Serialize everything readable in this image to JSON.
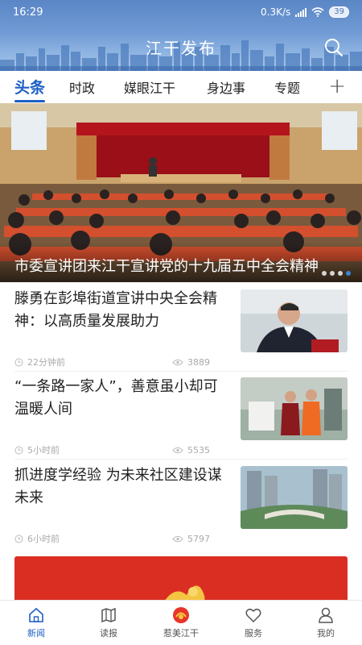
{
  "status_bar": {
    "time": "16:29",
    "network_speed": "0.3K/s",
    "battery": "39"
  },
  "header": {
    "title": "江干发布",
    "search_icon": "search-icon"
  },
  "tabs": [
    {
      "label": "头条",
      "active": true
    },
    {
      "label": "时政",
      "active": false
    },
    {
      "label": "媒眼江干",
      "active": false
    },
    {
      "label": "身边事",
      "active": false
    },
    {
      "label": "专题",
      "active": false
    }
  ],
  "add_tab_label": "+",
  "hero": {
    "caption": "市委宣讲团来江干宣讲党的十九届五中全会精神",
    "dots_count": 4,
    "active_dot": 3
  },
  "news": [
    {
      "title": "滕勇在彭埠街道宣讲中央全会精神：以高质量发展助力",
      "time": "22分钟前",
      "views": "3889"
    },
    {
      "title": "“一条路一家人”，善意虽小却可温暖人间",
      "time": "5小时前",
      "views": "5535"
    },
    {
      "title": "抓进度学经验 为未来社区建设谋未来",
      "time": "6小时前",
      "views": "5797"
    }
  ],
  "bottom_nav": [
    {
      "label": "新闻",
      "icon": "home-icon",
      "active": true
    },
    {
      "label": "读报",
      "icon": "map-icon",
      "active": false
    },
    {
      "label": "惹美江干",
      "icon": "emblem-icon",
      "active": false
    },
    {
      "label": "服务",
      "icon": "heart-icon",
      "active": false
    },
    {
      "label": "我的",
      "icon": "user-icon",
      "active": false
    }
  ],
  "colors": {
    "accent": "#1d5fc4",
    "header_top": "#5a86c6",
    "header_bottom": "#aac6ea"
  }
}
